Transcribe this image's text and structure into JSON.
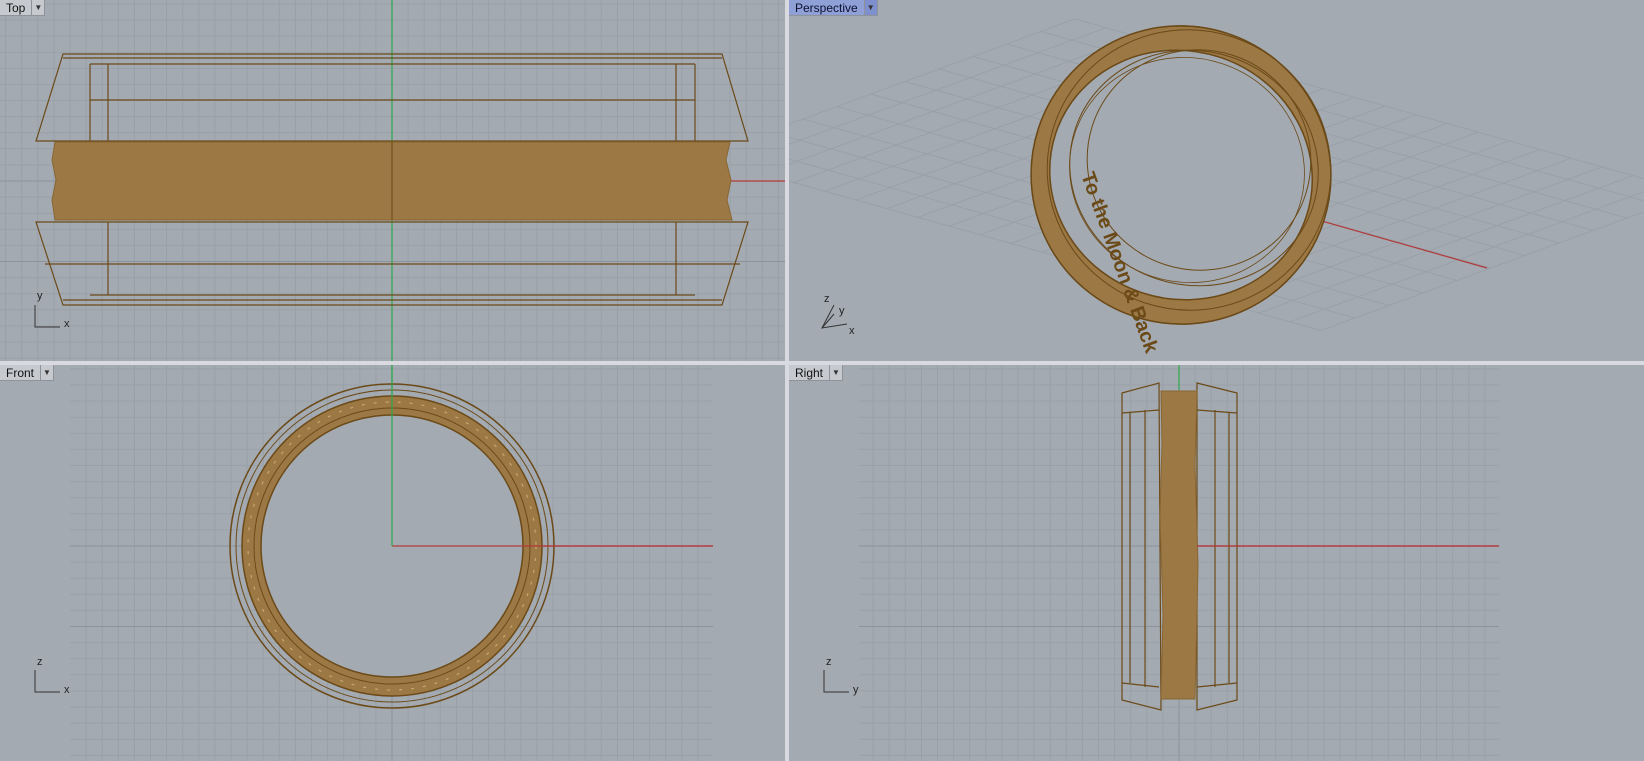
{
  "viewports": {
    "top": {
      "label": "Top",
      "axis_x": "x",
      "axis_y": "y"
    },
    "perspective": {
      "label": "Perspective",
      "axis_x": "x",
      "axis_y": "y",
      "axis_z": "z",
      "engraving": "To the Moon & Back"
    },
    "front": {
      "label": "Front",
      "axis_x": "x",
      "axis_y": "z"
    },
    "right": {
      "label": "Right",
      "axis_x": "y",
      "axis_y": "z"
    }
  },
  "colors": {
    "viewport_bg": "#a4aab2",
    "grid_minor": "#98a0a8",
    "grid_major": "#8c939b",
    "object_fill": "#9b7844",
    "object_wire": "#6b4a18",
    "x_axis": "#b23a3a",
    "y_axis": "#2ea84a",
    "active_label": "#8fa0d6"
  },
  "icons": {
    "dropdown": "triangle-down-icon"
  }
}
